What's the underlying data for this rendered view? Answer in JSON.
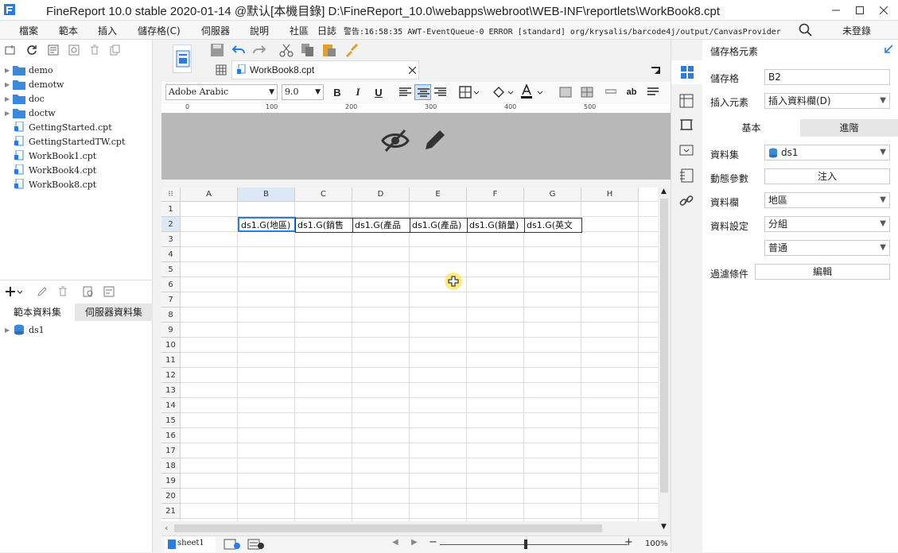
{
  "window": {
    "title": "FineReport 10.0 stable 2020-01-14 @默认[本機目錄]    D:\\FineReport_10.0\\webapps\\webroot\\WEB-INF\\reportlets\\WorkBook8.cpt"
  },
  "menubar": {
    "items": [
      "檔案",
      "範本",
      "插入",
      "儲存格(C)",
      "伺服器",
      "說明",
      "社區",
      "日誌"
    ],
    "log_text": "警告:16:58:35 AWT-EventQueue-0 ERROR [standard] org/krysalis/barcode4j/output/CanvasProvider",
    "login": "未登錄"
  },
  "file_tree": {
    "items": [
      {
        "name": "demo",
        "type": "folder"
      },
      {
        "name": "demotw",
        "type": "folder"
      },
      {
        "name": "doc",
        "type": "folder"
      },
      {
        "name": "doctw",
        "type": "folder"
      },
      {
        "name": "GettingStarted.cpt",
        "type": "file"
      },
      {
        "name": "GettingStartedTW.cpt",
        "type": "file"
      },
      {
        "name": "WorkBook1.cpt",
        "type": "file"
      },
      {
        "name": "WorkBook4.cpt",
        "type": "file"
      },
      {
        "name": "WorkBook8.cpt",
        "type": "file"
      }
    ]
  },
  "datasets": {
    "tabs": [
      "範本資料集",
      "伺服器資料集"
    ],
    "items": [
      "ds1"
    ]
  },
  "editor": {
    "tab_label": "WorkBook8.cpt",
    "font_name": "Adobe Arabic",
    "font_size": "9.0",
    "ruler_marks": [
      "0",
      "100",
      "200",
      "300",
      "400",
      "500"
    ],
    "columns": [
      "A",
      "B",
      "C",
      "D",
      "E",
      "F",
      "G",
      "H"
    ],
    "rows": [
      "1",
      "2",
      "3",
      "4",
      "5",
      "6",
      "7",
      "8",
      "9",
      "10",
      "11",
      "12",
      "13",
      "14",
      "15",
      "16",
      "17",
      "18",
      "19",
      "20",
      "21"
    ],
    "cells": {
      "B2": "ds1.G(地區)",
      "C2": "ds1.G(銷售",
      "D2": "ds1.G(產品",
      "E2": "ds1.G(產品)",
      "F2": "ds1.G(銷量)",
      "G2": "ds1.G(英文"
    },
    "sheet_name": "sheet1",
    "zoom": "100%"
  },
  "right_panel": {
    "title": "儲存格元素",
    "cell_label": "儲存格",
    "cell_value": "B2",
    "insert_label": "插入元素",
    "insert_value": "插入資料欄(D)",
    "tabs": [
      "基本",
      "進階"
    ],
    "dataset_label": "資料集",
    "dataset_value": "ds1",
    "dynamic_label": "動態參數",
    "dynamic_btn": "注入",
    "column_label": "資料欄",
    "column_value": "地區",
    "setting_label": "資料設定",
    "setting_value": "分組",
    "setting_sub": "普通",
    "filter_label": "過濾條件",
    "filter_btn": "編輯"
  },
  "colors": {
    "accent": "#2b7be5",
    "header_band": "#b8b8b8",
    "selected_header": "#dce8f5"
  }
}
